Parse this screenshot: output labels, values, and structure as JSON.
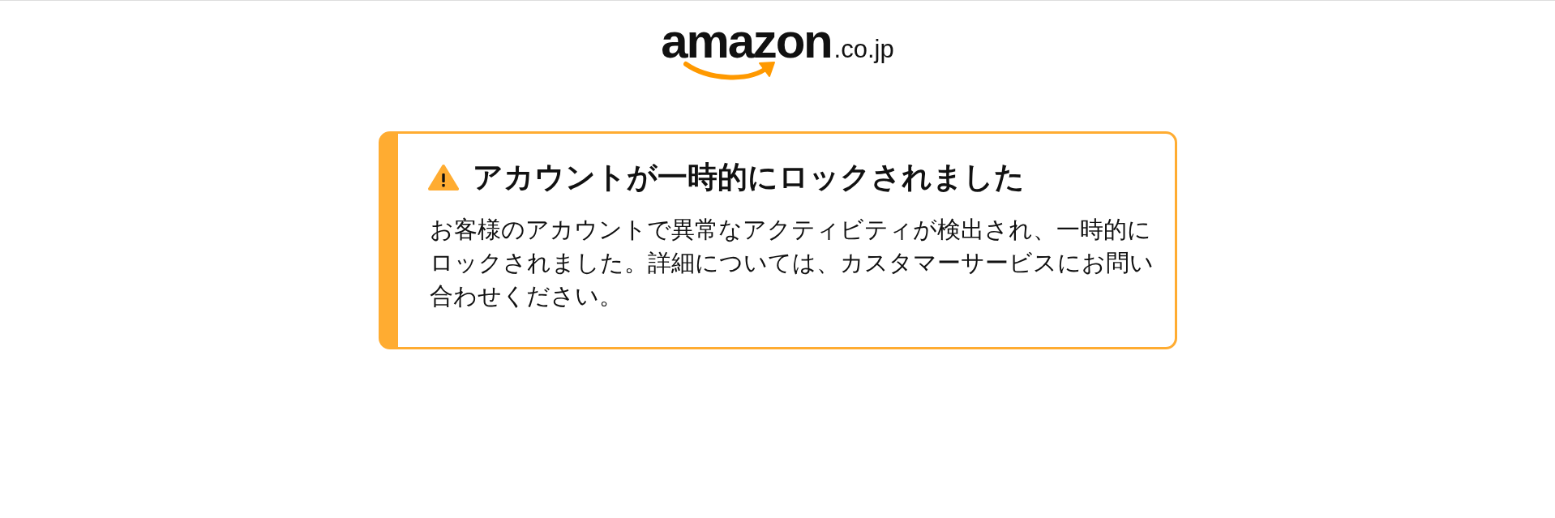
{
  "header": {
    "logo": {
      "wordmark": "amazon",
      "domain": ".co.jp"
    }
  },
  "alert": {
    "title": "アカウントが一時的にロックされました",
    "message": "お客様のアカウントで異常なアクティビティが検出され、一時的にロックされました。詳細については、カスタマーサービスにお問い合わせください。"
  }
}
